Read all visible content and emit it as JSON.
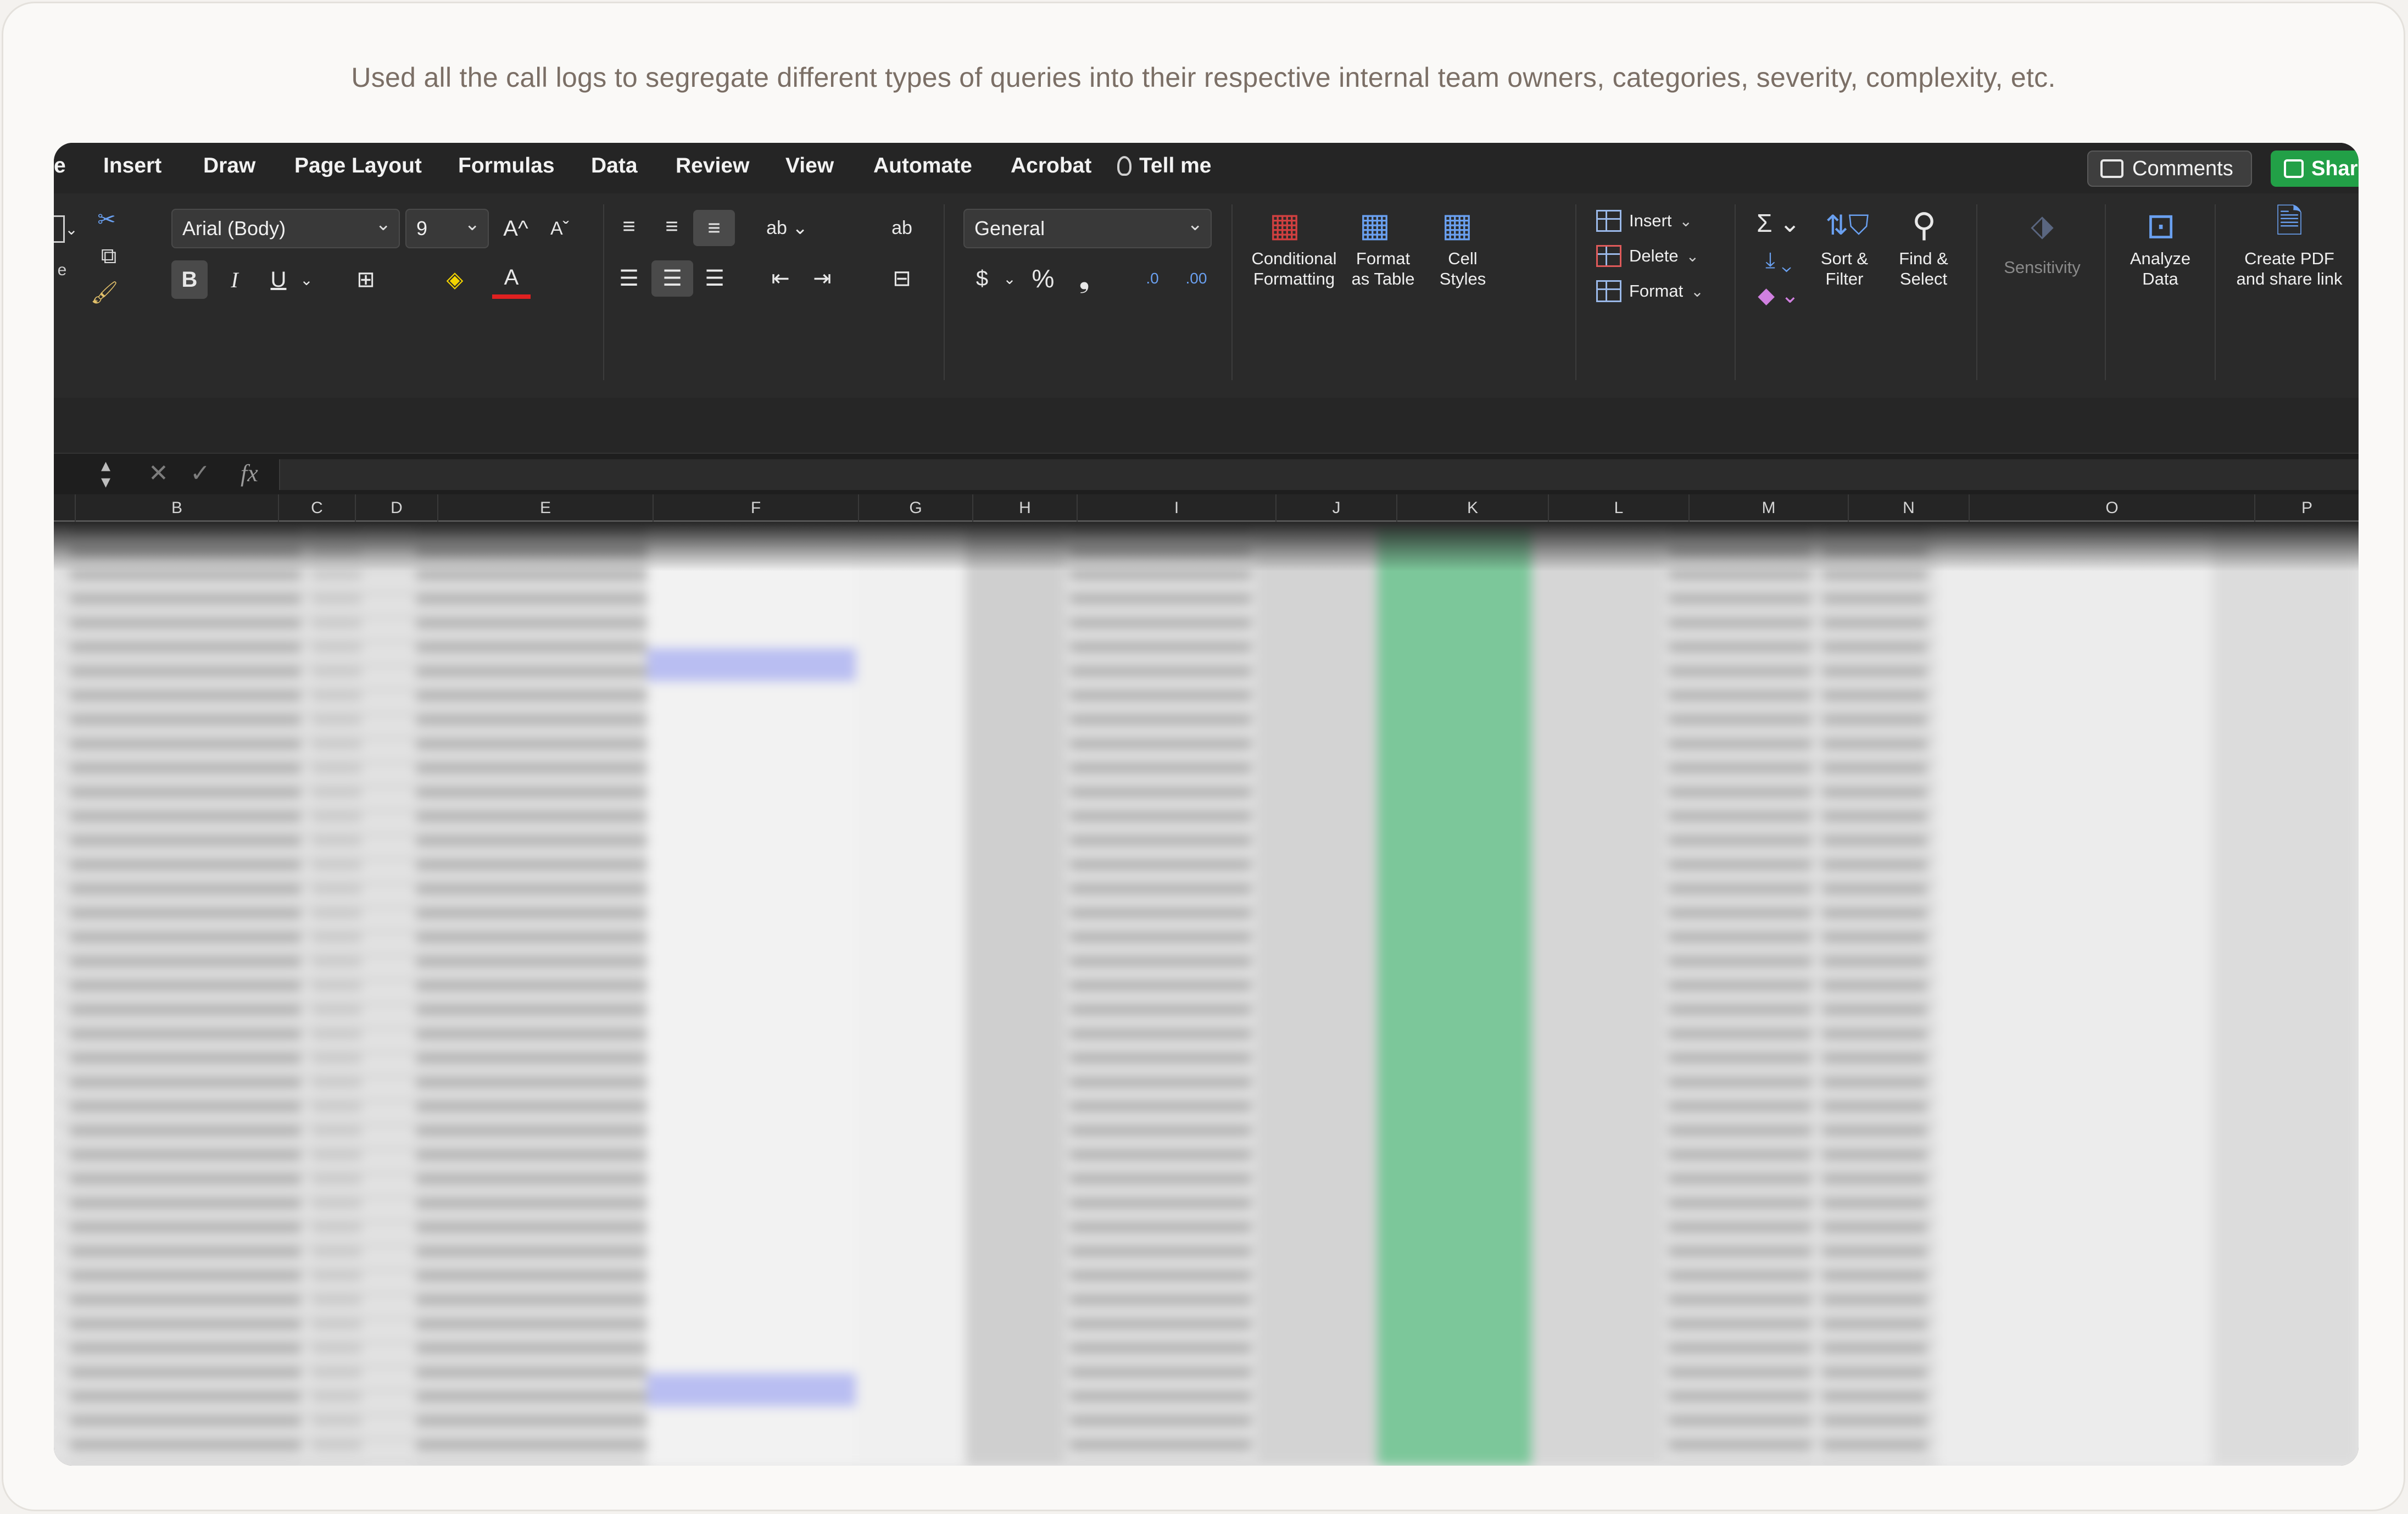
{
  "caption": "Used all the call logs to segregate different types of queries into their respective internal team owners, categories, severity, complexity, etc.",
  "menu": {
    "items": [
      "e",
      "Insert",
      "Draw",
      "Page Layout",
      "Formulas",
      "Data",
      "Review",
      "View",
      "Automate",
      "Acrobat"
    ],
    "tell_me": "Tell me",
    "comments": "Comments",
    "share": "Shar"
  },
  "ribbon": {
    "font_name": "Arial (Body)",
    "font_size": "9",
    "number_format": "General",
    "bold": "B",
    "italic": "I",
    "underline": "U",
    "grow_font": "A^",
    "shrink_font": "Aˇ",
    "font_color_glyph": "A",
    "currency": "$",
    "percent": "%",
    "comma": "❟",
    "inc_decimal": ".0",
    "dec_decimal": ".00",
    "wrap_glyph": "ab",
    "conditional_formatting": [
      "Conditional",
      "Formatting"
    ],
    "format_as_table": [
      "Format",
      "as Table"
    ],
    "cell_styles": [
      "Cell",
      "Styles"
    ],
    "insert": "Insert",
    "delete": "Delete",
    "format": "Format",
    "sort_filter": [
      "Sort &",
      "Filter"
    ],
    "find_select": [
      "Find &",
      "Select"
    ],
    "sensitivity": "Sensitivity",
    "analyze_data": [
      "Analyze",
      "Data"
    ],
    "create_pdf": [
      "Create PDF",
      "and share link"
    ],
    "clipboard_label": "e"
  },
  "formula_bar": {
    "fx": "fx",
    "cancel": "✕",
    "enter": "✓"
  },
  "columns": [
    "B",
    "C",
    "D",
    "E",
    "F",
    "G",
    "H",
    "I",
    "J",
    "K",
    "L",
    "M",
    "N",
    "O",
    "P"
  ],
  "colors": {
    "share_green": "#22a047",
    "highlight_green": "#7cc79a",
    "highlight_blue": "#b9bef2",
    "accent_blue": "#6aa0f0"
  }
}
